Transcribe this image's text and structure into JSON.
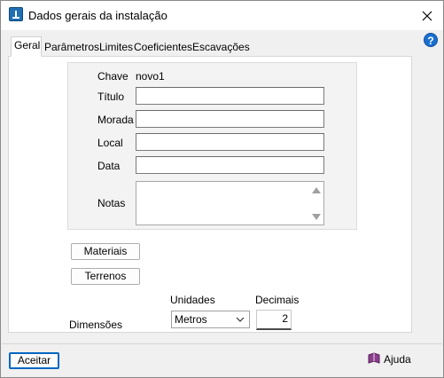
{
  "window": {
    "title": "Dados gerais da instalação"
  },
  "tabs": [
    {
      "label": "Geral"
    },
    {
      "label": "Parâmetros"
    },
    {
      "label": "Limites"
    },
    {
      "label": "Coeficientes"
    },
    {
      "label": "Escavações"
    }
  ],
  "form": {
    "chave_label": "Chave",
    "chave_value": "novo1",
    "titulo_label": "Título",
    "titulo_value": "",
    "morada_label": "Morada",
    "morada_value": "",
    "local_label": "Local",
    "local_value": "",
    "data_label": "Data",
    "data_value": "",
    "notas_label": "Notas",
    "notas_value": ""
  },
  "buttons": {
    "materiais": "Materiais",
    "terrenos": "Terrenos",
    "aceitar": "Aceitar",
    "ajuda": "Ajuda"
  },
  "dimensions": {
    "label": "Dimensões",
    "unidades_label": "Unidades",
    "unidades_value": "Metros",
    "decimais_label": "Decimais",
    "decimais_value": "2"
  },
  "icons": {
    "app": "app-icon",
    "close": "close-icon",
    "help": "help-icon",
    "book": "book-icon",
    "dropdown": "chevron-down-icon"
  }
}
